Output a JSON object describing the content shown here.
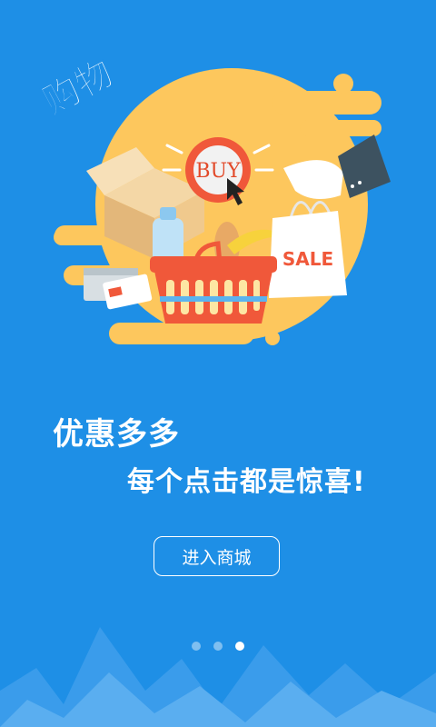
{
  "hero": {
    "badge": "购物",
    "buy_label": "BUY",
    "sale_label": "SALE"
  },
  "content": {
    "headline": "优惠多多",
    "subline": "每个点击都是惊喜!"
  },
  "cta": {
    "label": "进入商城"
  },
  "pager": {
    "count": 3,
    "active_index": 2
  },
  "colors": {
    "background": "#1e8fe6",
    "accent_yellow": "#fdc75d",
    "basket": "#f0583a"
  }
}
